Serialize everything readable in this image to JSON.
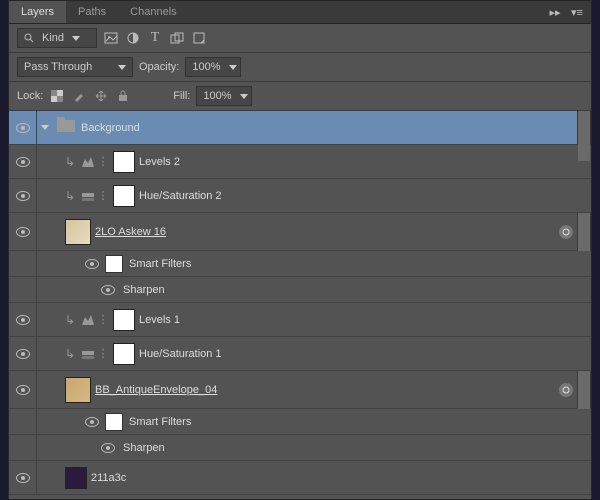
{
  "tabs": {
    "layers": "Layers",
    "paths": "Paths",
    "channels": "Channels"
  },
  "filter": {
    "kind": "Kind"
  },
  "blend": {
    "mode": "Pass Through",
    "opacity_label": "Opacity:",
    "opacity": "100%",
    "lock_label": "Lock:",
    "fill_label": "Fill:",
    "fill": "100%"
  },
  "layers": [
    {
      "name": "Background"
    },
    {
      "name": "Levels 2"
    },
    {
      "name": "Hue/Saturation 2"
    },
    {
      "name": "2LO Askew 16"
    },
    {
      "name": "Smart Filters"
    },
    {
      "name": "Sharpen"
    },
    {
      "name": "Levels 1"
    },
    {
      "name": "Hue/Saturation 1"
    },
    {
      "name": "BB_AntiqueEnvelope_04"
    },
    {
      "name": "Smart Filters"
    },
    {
      "name": "Sharpen"
    },
    {
      "name": "211a3c"
    }
  ]
}
